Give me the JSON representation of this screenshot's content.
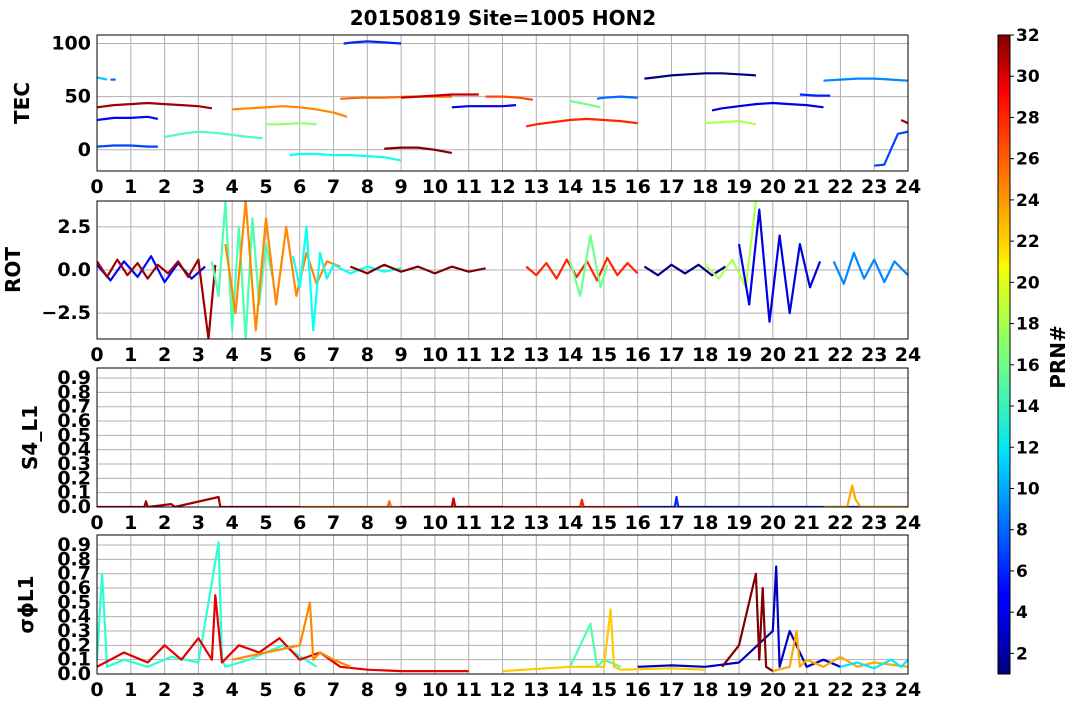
{
  "figure": {
    "title": "20150819 Site=1005 HON2",
    "x_ticks": [
      "0",
      "1",
      "2",
      "3",
      "4",
      "5",
      "6",
      "7",
      "8",
      "9",
      "10",
      "11",
      "12",
      "13",
      "14",
      "15",
      "16",
      "17",
      "18",
      "19",
      "20",
      "21",
      "22",
      "23",
      "24"
    ]
  },
  "colorbar": {
    "label": "PRN#",
    "range": [
      1,
      32
    ],
    "ticks": [
      "2",
      "4",
      "6",
      "8",
      "10",
      "12",
      "14",
      "16",
      "18",
      "20",
      "22",
      "24",
      "26",
      "28",
      "30",
      "32"
    ]
  },
  "chart_data": [
    {
      "type": "line",
      "panel": "TEC",
      "ylabel": "TEC",
      "xlim": [
        0,
        24
      ],
      "ylim": [
        -20,
        108
      ],
      "yticks": [
        "0",
        "50",
        "100"
      ],
      "grid": true,
      "series": [
        {
          "prn": 11,
          "x": [
            0.0,
            0.3
          ],
          "y": [
            68,
            66
          ]
        },
        {
          "prn": 8,
          "x": [
            0.4,
            0.55
          ],
          "y": [
            66,
            66
          ]
        },
        {
          "prn": 31,
          "x": [
            0.0,
            0.5,
            1.0,
            1.5,
            2.0,
            2.5,
            3.0,
            3.4
          ],
          "y": [
            40,
            42,
            43,
            44,
            43,
            42,
            41,
            39
          ]
        },
        {
          "prn": 5,
          "x": [
            0.0,
            0.5,
            1.0,
            1.5,
            1.8
          ],
          "y": [
            28,
            30,
            30,
            31,
            29
          ]
        },
        {
          "prn": 7,
          "x": [
            0.0,
            0.5,
            1.0,
            1.5,
            1.8
          ],
          "y": [
            3,
            4,
            4,
            3,
            3
          ]
        },
        {
          "prn": 15,
          "x": [
            2.0,
            2.5,
            3.0,
            3.5,
            4.0,
            4.5,
            4.9
          ],
          "y": [
            12,
            15,
            17,
            16,
            14,
            12,
            11
          ]
        },
        {
          "prn": 24,
          "x": [
            4.0,
            4.5,
            5.0,
            5.5,
            6.0,
            6.5,
            7.0,
            7.4
          ],
          "y": [
            38,
            39,
            40,
            41,
            40,
            38,
            35,
            31
          ]
        },
        {
          "prn": 17,
          "x": [
            5.0,
            5.5,
            6.0,
            6.5
          ],
          "y": [
            24,
            24,
            25,
            24
          ]
        },
        {
          "prn": 13,
          "x": [
            5.7,
            6.0,
            6.5,
            7.0,
            7.5,
            8.0,
            8.5,
            9.0
          ],
          "y": [
            -5,
            -4,
            -4,
            -5,
            -5,
            -6,
            -7,
            -10
          ]
        },
        {
          "prn": 6,
          "x": [
            7.3,
            7.6,
            8.0,
            8.5,
            9.0
          ],
          "y": [
            100,
            101,
            102,
            101,
            100
          ]
        },
        {
          "prn": 25,
          "x": [
            7.2,
            7.8,
            8.5,
            9.2,
            10.0,
            10.5
          ],
          "y": [
            48,
            49,
            49,
            50,
            50,
            50
          ]
        },
        {
          "prn": 30,
          "x": [
            9.0,
            9.5,
            10.0,
            10.5,
            11.0,
            11.3
          ],
          "y": [
            49,
            50,
            51,
            52,
            52,
            52
          ]
        },
        {
          "prn": 32,
          "x": [
            8.5,
            9.0,
            9.5,
            10.0,
            10.5
          ],
          "y": [
            1,
            2,
            2,
            0,
            -3
          ]
        },
        {
          "prn": 26,
          "x": [
            11.5,
            12.0,
            12.5,
            12.9
          ],
          "y": [
            50,
            50,
            49,
            47
          ]
        },
        {
          "prn": 4,
          "x": [
            10.5,
            11.0,
            11.5,
            12.0,
            12.4
          ],
          "y": [
            40,
            41,
            41,
            41,
            42
          ]
        },
        {
          "prn": 27,
          "x": [
            12.7,
            13.0,
            13.5,
            14.0,
            14.5,
            15.0,
            15.5,
            16.0
          ],
          "y": [
            22,
            24,
            26,
            28,
            29,
            28,
            27,
            25
          ]
        },
        {
          "prn": 16,
          "x": [
            14.0,
            14.3,
            14.6,
            14.9
          ],
          "y": [
            46,
            44,
            42,
            40
          ]
        },
        {
          "prn": 8,
          "x": [
            14.8,
            15.0,
            15.5,
            16.0
          ],
          "y": [
            48,
            49,
            50,
            49
          ]
        },
        {
          "prn": 1,
          "x": [
            16.2,
            16.5,
            17.0,
            17.5,
            18.0,
            18.5,
            19.0,
            19.5
          ],
          "y": [
            67,
            68,
            70,
            71,
            72,
            72,
            71,
            70
          ]
        },
        {
          "prn": 4,
          "x": [
            18.2,
            18.5,
            19.0,
            19.5,
            20.0,
            20.5,
            21.0,
            21.5
          ],
          "y": [
            37,
            39,
            41,
            43,
            44,
            43,
            42,
            40
          ]
        },
        {
          "prn": 18,
          "x": [
            18.0,
            18.5,
            19.0,
            19.5
          ],
          "y": [
            25,
            26,
            27,
            24
          ]
        },
        {
          "prn": 9,
          "x": [
            21.5,
            22.0,
            22.5,
            23.0,
            23.5,
            24.0
          ],
          "y": [
            65,
            66,
            67,
            67,
            66,
            65
          ]
        },
        {
          "prn": 6,
          "x": [
            20.8,
            21.3,
            21.7
          ],
          "y": [
            52,
            51,
            51
          ]
        },
        {
          "prn": 31,
          "x": [
            23.8,
            24.0
          ],
          "y": [
            28,
            25
          ]
        },
        {
          "prn": 7,
          "x": [
            23.0,
            23.3,
            23.7,
            24.0
          ],
          "y": [
            -15,
            -14,
            15,
            17
          ]
        }
      ]
    },
    {
      "type": "line",
      "panel": "ROT",
      "ylabel": "ROT",
      "xlim": [
        0,
        24
      ],
      "ylim": [
        -4,
        4
      ],
      "yticks": [
        "−2.5",
        "0.0",
        "2.5"
      ],
      "grid": true,
      "series": [
        {
          "prn": 5,
          "x": [
            0.0,
            0.4,
            0.8,
            1.2,
            1.6,
            2.0,
            2.4,
            2.8,
            3.2
          ],
          "y": [
            0.3,
            -0.6,
            0.5,
            -0.4,
            0.8,
            -0.7,
            0.4,
            -0.5,
            0.2
          ]
        },
        {
          "prn": 31,
          "x": [
            0.0,
            0.3,
            0.6,
            0.9,
            1.2,
            1.5,
            1.8,
            2.1,
            2.4,
            2.7,
            3.0,
            3.3,
            3.5
          ],
          "y": [
            0.5,
            -0.4,
            0.6,
            -0.3,
            0.4,
            -0.5,
            0.3,
            -0.2,
            0.5,
            -0.4,
            0.6,
            -4,
            0.3
          ]
        },
        {
          "prn": 15,
          "x": [
            3.4,
            3.6,
            3.8,
            4.0,
            4.2,
            4.4,
            4.6,
            4.8,
            5.0,
            5.2
          ],
          "y": [
            0.5,
            -1.5,
            4,
            -3.5,
            2.5,
            -4,
            3,
            -2,
            1.5,
            -0.5
          ]
        },
        {
          "prn": 24,
          "x": [
            3.8,
            4.1,
            4.4,
            4.7,
            5.0,
            5.3,
            5.6,
            5.9,
            6.2,
            6.5,
            6.8,
            7.2
          ],
          "y": [
            1.5,
            -2.5,
            4,
            -3.5,
            3,
            -2,
            2.5,
            -1.5,
            1,
            -0.8,
            0.5,
            0.2
          ]
        },
        {
          "prn": 13,
          "x": [
            5.8,
            6.0,
            6.2,
            6.4,
            6.6,
            6.8,
            7.0,
            7.5,
            8.0,
            8.5,
            9.0
          ],
          "y": [
            0.8,
            -1,
            2.5,
            -3.5,
            1,
            -0.5,
            0.3,
            -0.2,
            0.2,
            -0.1,
            0.1
          ]
        },
        {
          "prn": 32,
          "x": [
            7.5,
            8.0,
            8.5,
            9.0,
            9.5,
            10.0,
            10.5,
            11.0,
            11.5
          ],
          "y": [
            0.2,
            -0.2,
            0.3,
            -0.1,
            0.2,
            -0.2,
            0.2,
            -0.1,
            0.1
          ]
        },
        {
          "prn": 27,
          "x": [
            12.7,
            13.0,
            13.3,
            13.6,
            13.9,
            14.2,
            14.5,
            14.8,
            15.1,
            15.4,
            15.7,
            16.0
          ],
          "y": [
            0.2,
            -0.3,
            0.4,
            -0.5,
            0.6,
            -0.4,
            0.5,
            -0.6,
            0.7,
            -0.3,
            0.4,
            -0.2
          ]
        },
        {
          "prn": 16,
          "x": [
            14.0,
            14.3,
            14.6,
            14.9,
            15.1
          ],
          "y": [
            0.5,
            -1.5,
            2,
            -1,
            0.3
          ]
        },
        {
          "prn": 1,
          "x": [
            16.2,
            16.6,
            17.0,
            17.4,
            17.8,
            18.2,
            18.6
          ],
          "y": [
            0.2,
            -0.3,
            0.3,
            -0.2,
            0.3,
            -0.3,
            0.2
          ]
        },
        {
          "prn": 18,
          "x": [
            18.0,
            18.4,
            18.8,
            19.2,
            19.5
          ],
          "y": [
            0.3,
            -0.5,
            0.6,
            -1,
            4
          ]
        },
        {
          "prn": 4,
          "x": [
            19.0,
            19.3,
            19.6,
            19.9,
            20.2,
            20.5,
            20.8,
            21.1,
            21.4
          ],
          "y": [
            1.5,
            -2,
            3.5,
            -3,
            2,
            -2.5,
            1.5,
            -1,
            0.5
          ]
        },
        {
          "prn": 9,
          "x": [
            21.8,
            22.1,
            22.4,
            22.7,
            23.0,
            23.3,
            23.6,
            24.0
          ],
          "y": [
            0.5,
            -0.8,
            1,
            -0.5,
            0.6,
            -0.7,
            0.5,
            -0.3
          ]
        }
      ]
    },
    {
      "type": "line",
      "panel": "S4_L1",
      "ylabel": "S4_L1",
      "xlim": [
        0,
        24
      ],
      "ylim": [
        0,
        0.97
      ],
      "yticks": [
        "0.0",
        "0.1",
        "0.2",
        "0.3",
        "0.4",
        "0.5",
        "0.6",
        "0.7",
        "0.8",
        "0.9"
      ],
      "grid": true,
      "series": [
        {
          "prn": 31,
          "x": [
            0.0,
            1.4,
            1.45,
            1.5,
            2.2,
            2.3,
            3.6,
            3.65,
            3.7,
            6.0
          ],
          "y": [
            0.0,
            0.0,
            0.04,
            0.0,
            0.02,
            0.0,
            0.07,
            0.0,
            0.0,
            0.0
          ]
        },
        {
          "prn": 25,
          "x": [
            6.0,
            8.6,
            8.65,
            8.7,
            12.0
          ],
          "y": [
            0.0,
            0.0,
            0.04,
            0.0,
            0.0
          ]
        },
        {
          "prn": 30,
          "x": [
            9.0,
            10.5,
            10.55,
            10.6,
            12.0
          ],
          "y": [
            0.0,
            0.0,
            0.06,
            0.0,
            0.0
          ]
        },
        {
          "prn": 27,
          "x": [
            12.0,
            14.3,
            14.35,
            14.4,
            16.0
          ],
          "y": [
            0.0,
            0.0,
            0.05,
            0.0,
            0.0
          ]
        },
        {
          "prn": 6,
          "x": [
            16.0,
            17.1,
            17.15,
            17.2,
            20.0,
            24.0
          ],
          "y": [
            0.0,
            0.0,
            0.07,
            0.0,
            0.0,
            0.0
          ]
        },
        {
          "prn": 23,
          "x": [
            21.5,
            22.2,
            22.35,
            22.45,
            22.6,
            24.0
          ],
          "y": [
            0.0,
            0.0,
            0.15,
            0.05,
            0.0,
            0.0
          ]
        }
      ]
    },
    {
      "type": "line",
      "panel": "sigma_phi_L1",
      "ylabel": "σϕL1",
      "xlim": [
        0,
        24
      ],
      "ylim": [
        0,
        0.97
      ],
      "yticks": [
        "0.0",
        "0.1",
        "0.2",
        "0.3",
        "0.4",
        "0.5",
        "0.6",
        "0.7",
        "0.8",
        "0.9"
      ],
      "grid": true,
      "series": [
        {
          "prn": 14,
          "x": [
            0.0,
            0.15,
            0.3,
            0.8,
            1.5,
            2.2,
            3.0,
            3.6,
            3.7,
            3.8,
            4.5,
            5.5,
            6.5
          ],
          "y": [
            0.1,
            0.7,
            0.05,
            0.1,
            0.05,
            0.12,
            0.08,
            0.92,
            0.1,
            0.05,
            0.1,
            0.2,
            0.05
          ]
        },
        {
          "prn": 29,
          "x": [
            0.0,
            0.8,
            1.5,
            2.0,
            2.5,
            3.0,
            3.4,
            3.5,
            3.7,
            4.2,
            4.8,
            5.4,
            6.0,
            6.6,
            7.2,
            8.0,
            9.0,
            10.0,
            11.0
          ],
          "y": [
            0.05,
            0.15,
            0.08,
            0.2,
            0.1,
            0.25,
            0.1,
            0.55,
            0.08,
            0.2,
            0.15,
            0.25,
            0.1,
            0.15,
            0.05,
            0.03,
            0.02,
            0.02,
            0.02
          ]
        },
        {
          "prn": 24,
          "x": [
            4.0,
            5.0,
            6.0,
            6.3,
            6.4,
            6.6,
            7.0,
            7.5
          ],
          "y": [
            0.1,
            0.15,
            0.2,
            0.5,
            0.1,
            0.15,
            0.1,
            0.05
          ]
        },
        {
          "prn": 15,
          "x": [
            14.0,
            14.6,
            14.8,
            15.0,
            15.5
          ],
          "y": [
            0.05,
            0.35,
            0.05,
            0.1,
            0.05
          ]
        },
        {
          "prn": 22,
          "x": [
            12.0,
            14.0,
            15.0,
            15.2,
            15.3,
            15.5,
            17.0,
            18.0
          ],
          "y": [
            0.02,
            0.05,
            0.05,
            0.45,
            0.05,
            0.03,
            0.04,
            0.03
          ]
        },
        {
          "prn": 3,
          "x": [
            16.0,
            17.0,
            18.0,
            19.0,
            20.0,
            20.1,
            20.2,
            20.5,
            21.0,
            21.5,
            22.0
          ],
          "y": [
            0.05,
            0.06,
            0.05,
            0.08,
            0.3,
            0.75,
            0.05,
            0.3,
            0.05,
            0.1,
            0.05
          ]
        },
        {
          "prn": 32,
          "x": [
            18.5,
            19.0,
            19.5,
            19.6,
            19.7,
            19.8,
            20.0
          ],
          "y": [
            0.05,
            0.2,
            0.7,
            0.1,
            0.6,
            0.05,
            0.02
          ]
        },
        {
          "prn": 23,
          "x": [
            20.0,
            20.5,
            20.7,
            20.8,
            21.0,
            21.5,
            22.0,
            22.5,
            23.0,
            24.0
          ],
          "y": [
            0.02,
            0.05,
            0.3,
            0.05,
            0.1,
            0.05,
            0.12,
            0.05,
            0.08,
            0.05
          ]
        },
        {
          "prn": 12,
          "x": [
            22.0,
            22.5,
            23.0,
            23.5,
            23.8,
            24.0
          ],
          "y": [
            0.05,
            0.08,
            0.04,
            0.1,
            0.05,
            0.1
          ]
        }
      ]
    }
  ]
}
